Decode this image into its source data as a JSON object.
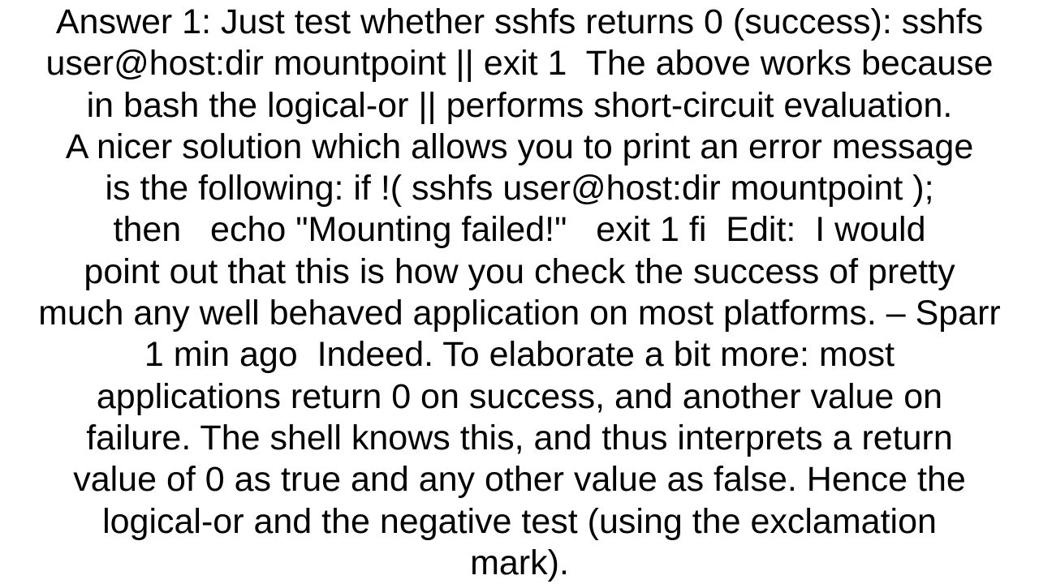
{
  "document": {
    "lines": [
      "Answer 1: Just test whether sshfs returns 0 (success): sshfs",
      "user@host:dir mountpoint || exit 1  The above works because",
      "in bash the logical-or || performs short-circuit evaluation.",
      "A nicer solution which allows you to print an error message",
      "is the following: if !( sshfs user@host:dir mountpoint );",
      "then   echo \"Mounting failed!\"   exit 1 fi  Edit:  I would",
      "point out that this is how you check the success of pretty",
      "much any well behaved application on most platforms. – Sparr",
      "1 min ago  Indeed. To elaborate a bit more: most",
      "applications return 0 on success, and another value on",
      "failure. The shell knows this, and thus interprets a return",
      "value of 0 as true and any other value as false. Hence the",
      "logical-or and the negative test (using the exclamation",
      "mark)."
    ]
  }
}
